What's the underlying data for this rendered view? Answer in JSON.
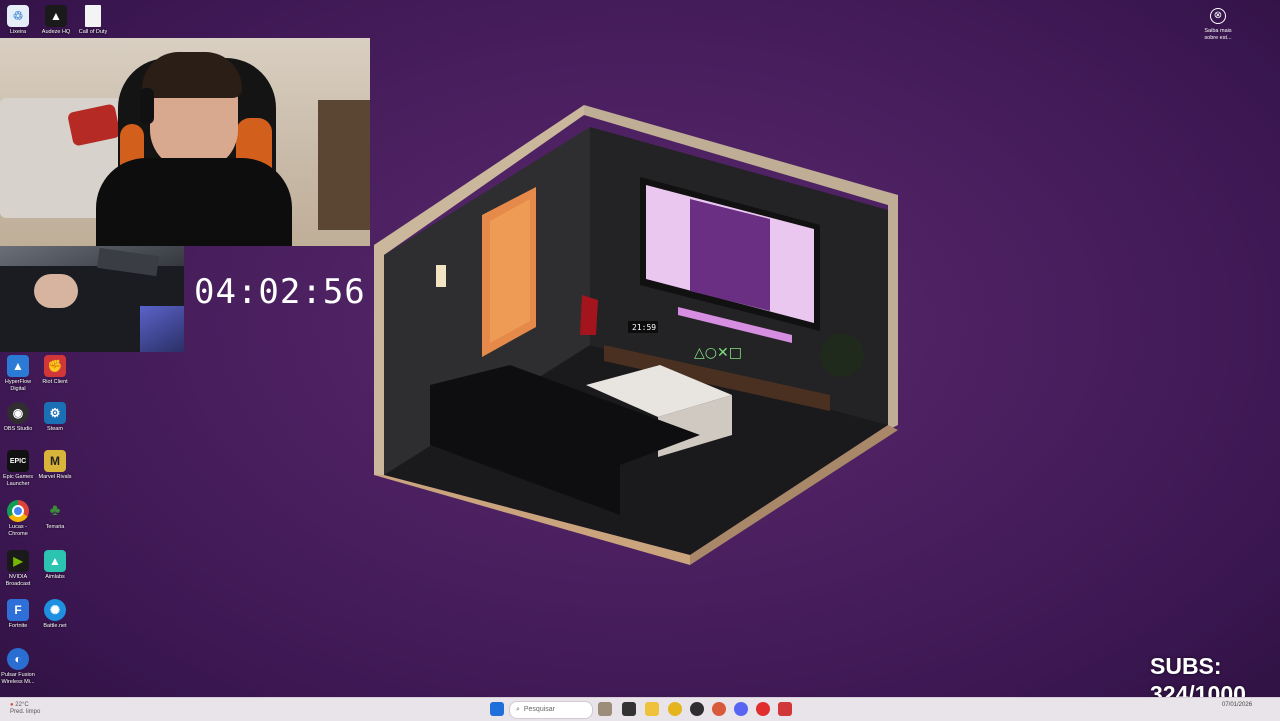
{
  "desktop_icons_top": [
    {
      "label": "Lixeira",
      "icon": "recycle-bin-icon",
      "color": "#4a90d9"
    },
    {
      "label": "Audeze HQ",
      "icon": "audeze-icon",
      "color": "#222222"
    },
    {
      "label": "Call of Duty",
      "icon": "file-icon",
      "color": "#f2f2f2"
    }
  ],
  "desktop_icons_left": [
    {
      "label": "HyperFlow Digital",
      "icon": "hyperflow-icon",
      "color": "#2b7bd6"
    },
    {
      "label": "Riot Client",
      "icon": "riot-icon",
      "color": "#d13639"
    },
    {
      "label": "OBS Studio",
      "icon": "obs-icon",
      "color": "#302e31"
    },
    {
      "label": "Steam",
      "icon": "steam-icon",
      "color": "#1b6fb5"
    },
    {
      "label": "Epic Games Launcher",
      "icon": "epic-games-icon",
      "color": "#111111"
    },
    {
      "label": "Marvel Rivals",
      "icon": "marvel-rivals-icon",
      "color": "#d9b43a"
    },
    {
      "label": "Lucas - Chrome",
      "icon": "chrome-icon",
      "color": "#e4b51e"
    },
    {
      "label": "Terraria",
      "icon": "terraria-icon",
      "color": "#3c8c3a"
    },
    {
      "label": "NVIDIA Broadcast",
      "icon": "nvidia-icon",
      "color": "#76b900"
    },
    {
      "label": "Aimlabs",
      "icon": "aimlabs-icon",
      "color": "#2bc4b0"
    },
    {
      "label": "Fortnite",
      "icon": "fortnite-icon",
      "color": "#2f6fd8"
    },
    {
      "label": "Battle.net",
      "icon": "battlenet-icon",
      "color": "#1f8fe0"
    },
    {
      "label": "Pulsar Fusion Wireless Mi...",
      "icon": "pulsar-icon",
      "color": "#2a6ed1"
    }
  ],
  "timer": "04:02:56",
  "notice": {
    "label": "Saiba mais sobre est..."
  },
  "subs": {
    "line1": "SUBS:",
    "line2": "324/1000"
  },
  "room_scene": {
    "clock": "21:59",
    "logo": "△○✕□"
  },
  "taskbar": {
    "weather": {
      "temp": "22°C",
      "desc": "Pred. limpo"
    },
    "search_placeholder": "Pesquisar",
    "date": "07/01/2026"
  },
  "colors": {
    "wallpaper": "#4a1f5e",
    "taskbar": "#e9e4ea",
    "text": "#ffffff"
  }
}
